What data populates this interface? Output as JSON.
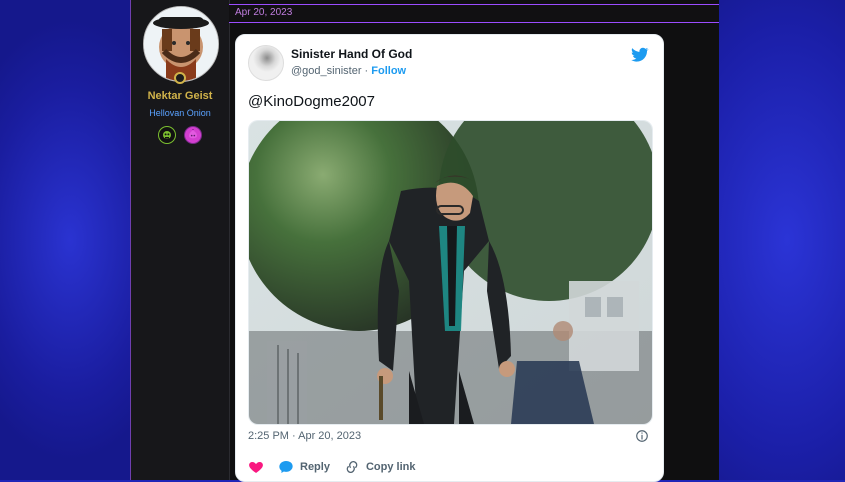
{
  "post": {
    "date": "Apr 20, 2023"
  },
  "user": {
    "name": "Nektar Geist",
    "title": "Hellovan Onion",
    "badges": [
      {
        "icon": "skull-badge-icon"
      },
      {
        "icon": "onion-badge-icon"
      }
    ]
  },
  "tweet": {
    "author_name": "Sinister Hand Of God",
    "handle": "@god_sinister",
    "follow_label": "Follow",
    "text": "@KinoDogme2007",
    "timestamp": "2:25 PM · Apr 20, 2023",
    "actions": {
      "reply": "Reply",
      "copy": "Copy link"
    }
  },
  "colors": {
    "background_blue": "#1b1fa8",
    "forum_accent_purple": "#9b4cff",
    "username_gold": "#d1b34a",
    "usertitle_blue": "#5aa2ff",
    "twitter_blue": "#1d9bf0",
    "like_pink": "#f91880"
  }
}
